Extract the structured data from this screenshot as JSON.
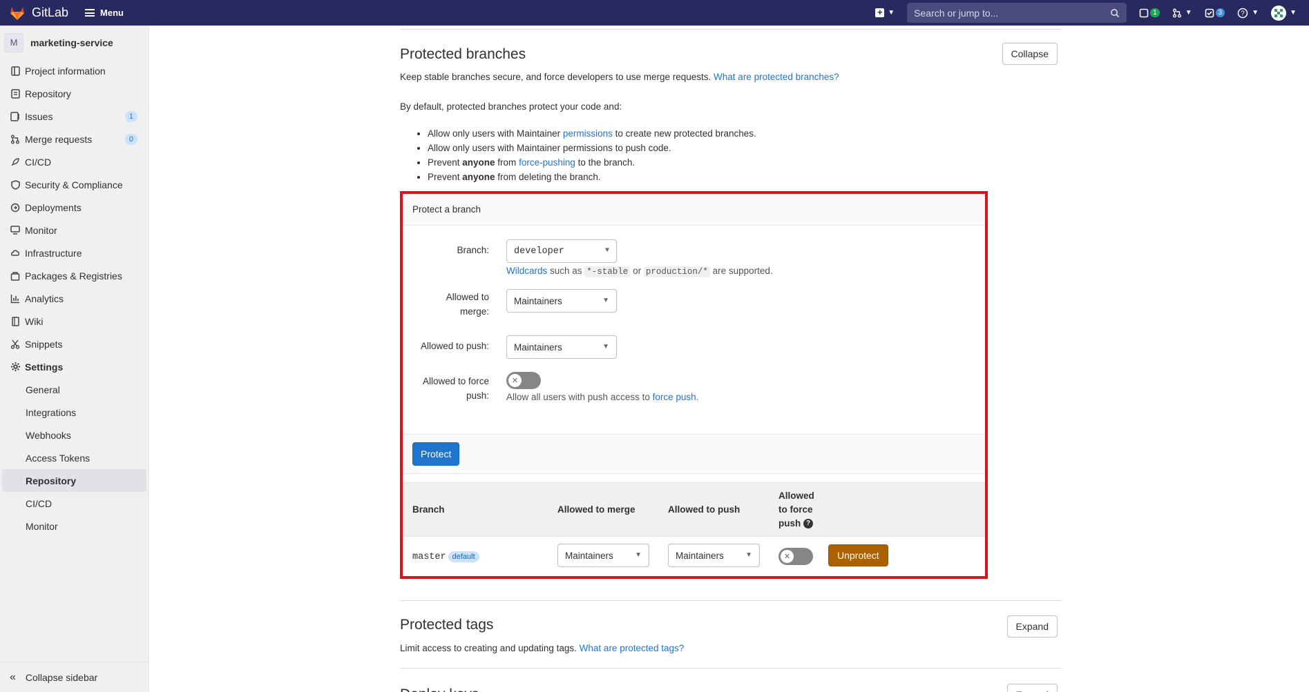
{
  "topbar": {
    "brand": "GitLab",
    "menu_label": "Menu",
    "search_placeholder": "Search or jump to...",
    "issues_count": "1",
    "todos_count": "3"
  },
  "sidebar": {
    "project_initial": "M",
    "project_name": "marketing-service",
    "items": [
      {
        "label": "Project information",
        "icon": "info-icon"
      },
      {
        "label": "Repository",
        "icon": "repository-icon"
      },
      {
        "label": "Issues",
        "icon": "issues-icon",
        "count": "1"
      },
      {
        "label": "Merge requests",
        "icon": "merge-request-icon",
        "count": "0"
      },
      {
        "label": "CI/CD",
        "icon": "rocket-icon"
      },
      {
        "label": "Security & Compliance",
        "icon": "shield-icon"
      },
      {
        "label": "Deployments",
        "icon": "deployments-icon"
      },
      {
        "label": "Monitor",
        "icon": "monitor-icon"
      },
      {
        "label": "Infrastructure",
        "icon": "cloud-icon"
      },
      {
        "label": "Packages & Registries",
        "icon": "package-icon"
      },
      {
        "label": "Analytics",
        "icon": "chart-icon"
      },
      {
        "label": "Wiki",
        "icon": "book-icon"
      },
      {
        "label": "Snippets",
        "icon": "scissors-icon"
      },
      {
        "label": "Settings",
        "icon": "gear-icon"
      }
    ],
    "settings_sub": [
      "General",
      "Integrations",
      "Webhooks",
      "Access Tokens",
      "Repository",
      "CI/CD",
      "Monitor"
    ],
    "active_sub": "Repository",
    "collapse_label": "Collapse sidebar"
  },
  "protected_branches": {
    "title": "Protected branches",
    "collapse_btn": "Collapse",
    "intro": "Keep stable branches secure, and force developers to use merge requests.",
    "intro_link": "What are protected branches?",
    "default_text": "By default, protected branches protect your code and:",
    "rule1_a": "Allow only users with Maintainer ",
    "rule1_link": "permissions",
    "rule1_b": " to create new protected branches.",
    "rule2": "Allow only users with Maintainer permissions to push code.",
    "rule3_a": "Prevent ",
    "rule3_bold": "anyone",
    "rule3_b": " from ",
    "rule3_link": "force-pushing",
    "rule3_c": " to the branch.",
    "rule4_a": "Prevent ",
    "rule4_bold": "anyone",
    "rule4_b": " from deleting the branch."
  },
  "protect_form": {
    "header": "Protect a branch",
    "branch_label": "Branch:",
    "branch_value": "developer",
    "wildcard_link": "Wildcards",
    "wildcard_a": " such as ",
    "wildcard_code1": "*-stable",
    "wildcard_or": " or ",
    "wildcard_code2": "production/*",
    "wildcard_b": " are supported.",
    "merge_label": "Allowed to merge:",
    "merge_value": "Maintainers",
    "push_label": "Allowed to push:",
    "push_value": "Maintainers",
    "force_label": "Allowed to force push:",
    "force_help_a": "Allow all users with push access to ",
    "force_help_link": "force push.",
    "protect_btn": "Protect"
  },
  "branch_table": {
    "headers": [
      "Branch",
      "Allowed to merge",
      "Allowed to push",
      "Allowed to force push"
    ],
    "rows": [
      {
        "branch": "master",
        "tag": "default",
        "merge": "Maintainers",
        "push": "Maintainers",
        "force_push": false,
        "action": "Unprotect"
      }
    ]
  },
  "protected_tags": {
    "title": "Protected tags",
    "expand_btn": "Expand",
    "intro": "Limit access to creating and updating tags.",
    "intro_link": "What are protected tags?"
  },
  "deploy_keys": {
    "title": "Deploy keys",
    "expand_btn": "Expand"
  },
  "colors": {
    "topbar": "#292961",
    "accent": "#1f75cb",
    "highlight": "#e0101a",
    "unprotect": "#ab6100"
  }
}
